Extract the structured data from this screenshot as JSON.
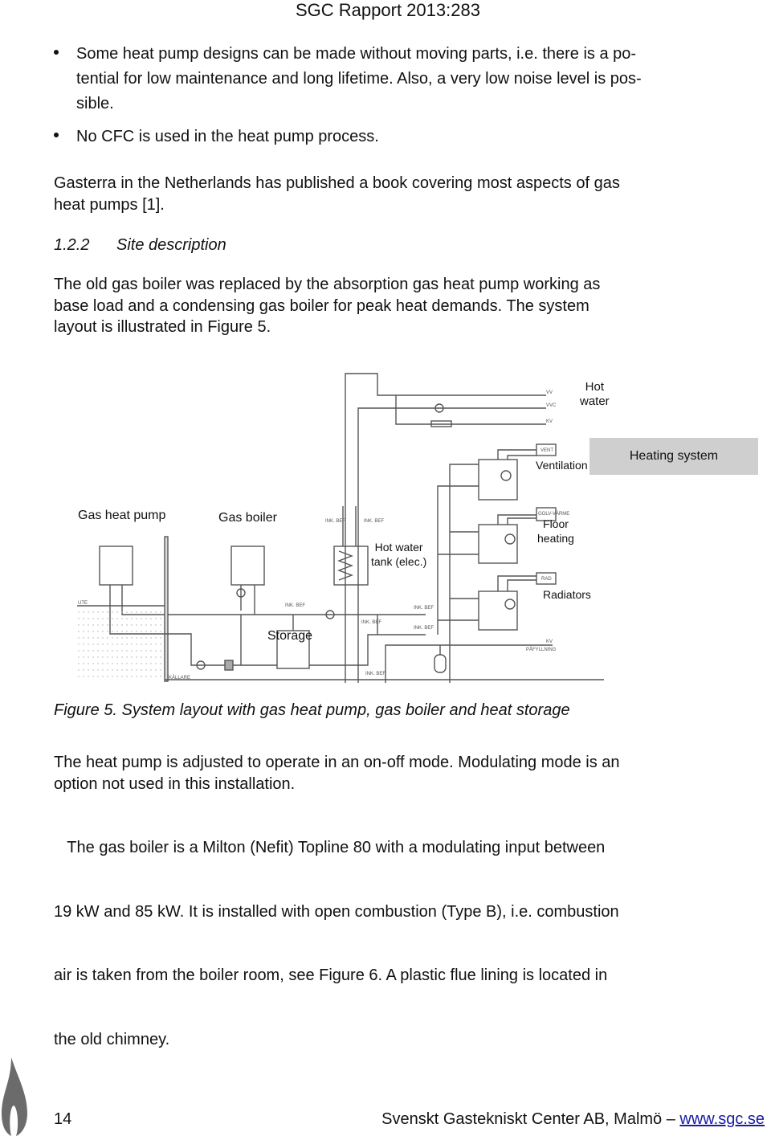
{
  "header": {
    "report_id": "SGC Rapport 2013:283"
  },
  "bullets": [
    "Some heat pump designs can be made without moving parts, i.e. there is a po-tential for low maintenance and long lifetime. Also, a very low noise level is pos-sible.",
    "No CFC is used in the heat pump process."
  ],
  "bullet_lines": [
    [
      "Some heat pump designs can be made without moving parts, i.e. there is a po-",
      "tential for low maintenance and long lifetime. Also, a very low noise level is pos-",
      "sible."
    ],
    [
      "No CFC is used in the heat pump process."
    ]
  ],
  "para_gasterra": [
    "Gasterra in the Netherlands has published a book covering most aspects of gas",
    "heat pumps [1]."
  ],
  "section": {
    "number": "1.2.2",
    "title": "Site description"
  },
  "para_site": [
    "The old gas boiler was replaced by the absorption gas heat pump working as",
    "base load and a condensing gas boiler for peak heat demands. The system",
    "layout is illustrated in Figure 5."
  ],
  "figure": {
    "labels": {
      "hot_water": [
        "Hot",
        "water"
      ],
      "heating_system": "Heating system",
      "ventilation": "Ventilation",
      "gas_heat_pump": "Gas heat pump",
      "gas_boiler": "Gas boiler",
      "hot_water_tank": [
        "Hot water",
        "tank (elec.)"
      ],
      "floor_heating": [
        "Floor",
        "heating"
      ],
      "radiators": "Radiators",
      "storage": "Storage"
    },
    "small_tags": {
      "vv": "VV",
      "vvc": "VVC",
      "kv": "KV",
      "vent": "VENT",
      "golv": "GOLV-VÄRME",
      "rad": "RAD",
      "ute": "UTE",
      "kallare": "KÄLLARE",
      "ink_bef": "INK. BEF",
      "pafyllning": "PÅFYLLNING",
      "kv2": "KV"
    },
    "caption": "Figure 5. System layout with gas heat pump, gas boiler and heat storage"
  },
  "para_mode": [
    "The heat pump is adjusted to operate in an on-off mode. Modulating mode is an",
    "option not used in this installation."
  ],
  "para_boiler": [
    "   The gas boiler is a Milton (Nefit) Topline 80 with a modulating input between",
    "19 kW and 85 kW. It is installed with open combustion (Type B), i.e. combustion",
    "air is taken from the boiler room, see Figure 6. A plastic flue lining is located in",
    "the old chimney."
  ],
  "footer": {
    "page_number": "14",
    "organization": "Svenskt Gastekniskt Center AB, Malmö – ",
    "website": "www.sgc.se",
    "logo_icon": "flame-icon"
  },
  "colors": {
    "link": "#1a1aa6",
    "flame": "#6b6b6b",
    "heating_box": "#cfcfcf"
  }
}
